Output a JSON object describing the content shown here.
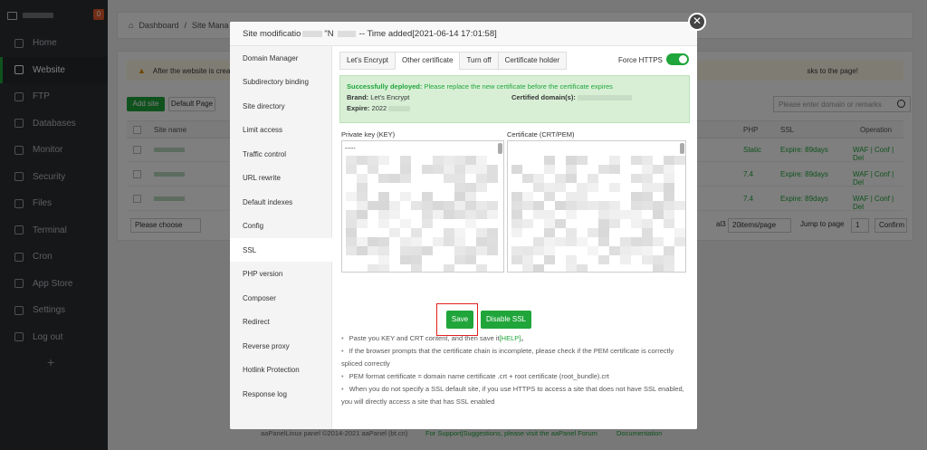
{
  "sidebar": {
    "badge": "0",
    "items": [
      {
        "label": "Home",
        "icon": "home-icon"
      },
      {
        "label": "Website",
        "icon": "globe-icon",
        "active": true
      },
      {
        "label": "FTP",
        "icon": "ftp-icon"
      },
      {
        "label": "Databases",
        "icon": "database-icon"
      },
      {
        "label": "Monitor",
        "icon": "monitor-icon"
      },
      {
        "label": "Security",
        "icon": "shield-icon"
      },
      {
        "label": "Files",
        "icon": "folder-icon"
      },
      {
        "label": "Terminal",
        "icon": "terminal-icon"
      },
      {
        "label": "Cron",
        "icon": "clock-icon"
      },
      {
        "label": "App Store",
        "icon": "store-icon"
      },
      {
        "label": "Settings",
        "icon": "gear-icon"
      },
      {
        "label": "Log out",
        "icon": "logout-icon"
      }
    ],
    "add": "+"
  },
  "breadcrumb": {
    "home": "Dashboard",
    "sep": "/",
    "current": "Site Mana"
  },
  "website": {
    "warning": "After the website is create",
    "warning_tail": "sks to the page!",
    "add_site": "Add site",
    "default_page": "Default Page",
    "search_placeholder": "Please enter domain or remarks",
    "headers": {
      "site_name": "Site name",
      "php": "PHP",
      "ssl": "SSL",
      "operation": "Operation"
    },
    "rows": [
      {
        "php": "Static",
        "ssl": "Expire: 89days",
        "ops": "WAF | Conf | Del"
      },
      {
        "php": "7.4",
        "ssl": "Expire: 89days",
        "ops": "WAF | Conf | Del"
      },
      {
        "php": "7.4",
        "ssl": "Expire: 89days",
        "ops": "WAF | Conf | Del"
      }
    ],
    "please_choose": "Please choose",
    "total": "al3",
    "per_page": "20items/page",
    "jump_to": "Jump to page",
    "page": "1",
    "confirm": "Confirm"
  },
  "footer": {
    "copyright": "aaPanelLinux panel ©2014-2021 aaPanel (bt.cn)",
    "support": "For Support|Suggestions, please visit the aaPanel Forum",
    "docs": "Documentation"
  },
  "modal": {
    "title_prefix": "Site modificatio",
    "title_mid": "\"N",
    "title_suffix": "-- Time added[2021-06-14 17:01:58]",
    "close": "✕",
    "nav": [
      "Domain Manager",
      "Subdirectory binding",
      "Site directory",
      "Limit access",
      "Traffic control",
      "URL rewrite",
      "Default indexes",
      "Config",
      "SSL",
      "PHP version",
      "Composer",
      "Redirect",
      "Reverse proxy",
      "Hotlink Protection",
      "Response log"
    ],
    "tabs": [
      "Let's Encrypt",
      "Other certificate",
      "Turn off",
      "Certificate holder"
    ],
    "force_https": "Force HTTPS",
    "success": {
      "head": "Successfully deployed:",
      "head_msg": "Please replace the new certificate before the certificate expires",
      "brand_label": "Brand:",
      "brand": "Let's Encrypt",
      "domains_label": "Certified domain(s):",
      "expire_label": "Expire:",
      "expire": "2022"
    },
    "key_label": "Private key (KEY)",
    "crt_label": "Certificate (CRT/PEM)",
    "key_start": "-----",
    "save": "Save",
    "disable_ssl": "Disable SSL",
    "tips": {
      "t1": "Paste you KEY and CRT content, and then save it",
      "t1_help": "[HELP]",
      "t1_end": "。",
      "t2": "If the browser prompts that the certificate chain is incomplete, please check if the PEM certificate is correctly spliced correctly",
      "t3": "PEM format certificate = domain name certificate .crt + root certificate (root_bundle).crt",
      "t4": "When you do not specify a SSL default site, if you use HTTPS to access a site that does not have SSL enabled, you will directly access a site that has SSL enabled"
    }
  }
}
